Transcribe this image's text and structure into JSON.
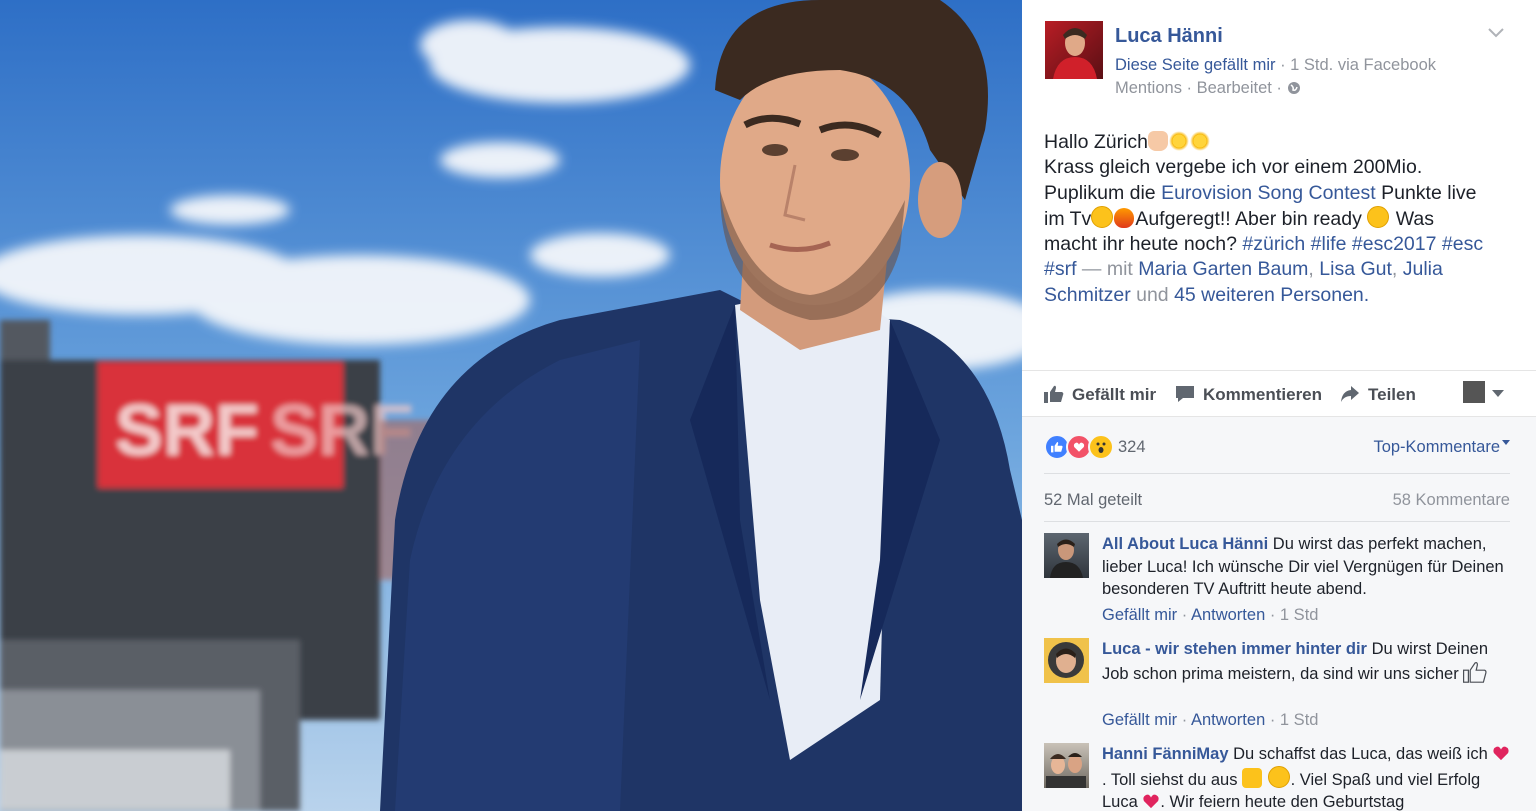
{
  "post": {
    "author": "Luca Hänni",
    "meta_line1": {
      "like_page": "Diese Seite gefällt mir",
      "sep": " · ",
      "time_via": "1 Std. via Facebook"
    },
    "meta_line2": {
      "mentions": "Mentions",
      "sep": " · ",
      "edited": "Bearbeitet",
      "sep2": " · "
    },
    "text": {
      "line1": "Hallo Zürich",
      "line2": "Krass gleich vergebe ich vor einem 200Mio.",
      "line3_a": "Puplikum die ",
      "line3_link": "Eurovision Song Contest",
      "line3_b": " Punkte live",
      "line4_a": "im Tv",
      "line4_b": "Aufgeregt!! Aber bin ready ",
      "line4_c": " Was",
      "line5_a": "macht ihr heute noch? ",
      "hashtags": [
        "#zürich",
        "#life",
        "#esc2017",
        "#esc",
        "#srf"
      ],
      "with": " — mit ",
      "tagged1": "Maria Garten Baum",
      "tagged2": "Lisa Gut",
      "tagged3": "Julia Schmitzer",
      "and": " und ",
      "others": "45 weiteren Personen."
    }
  },
  "photo": {
    "sign_text": "SRF"
  },
  "actions": {
    "like": "Gefällt mir",
    "comment": "Kommentieren",
    "share": "Teilen"
  },
  "stats": {
    "reactions_count": "324",
    "sort_label": "Top-Kommentare",
    "shares": "52 Mal geteilt",
    "comments": "58 Kommentare"
  },
  "comments": [
    {
      "name": "All About Luca Hänni",
      "text": " Du wirst das perfekt machen, lieber Luca! Ich wünsche Dir viel Vergnügen für Deinen besonderen TV Auftritt heute abend.",
      "like": "Gefällt mir",
      "reply": "Antworten",
      "time": "1 Std"
    },
    {
      "name": "Luca - wir stehen immer hinter dir",
      "text": " Du wirst Deinen Job schon prima meistern, da sind wir uns sicher",
      "like": "Gefällt mir",
      "reply": "Antworten",
      "time": "1 Std"
    },
    {
      "name": "Hanni FänniMay",
      "text_a": " Du schaffst das Luca, das weiß ich",
      "text_b": ". Toll siehst du aus ",
      "text_c": ". Viel Spaß und viel Erfolg Luca",
      "text_d": ". Wir feiern heute den Geburtstag"
    }
  ],
  "colors": {
    "link": "#365899",
    "meta": "#90949c",
    "like_blue": "#4080ff",
    "love_red": "#f25268",
    "wow_yellow": "#fcc21b"
  }
}
